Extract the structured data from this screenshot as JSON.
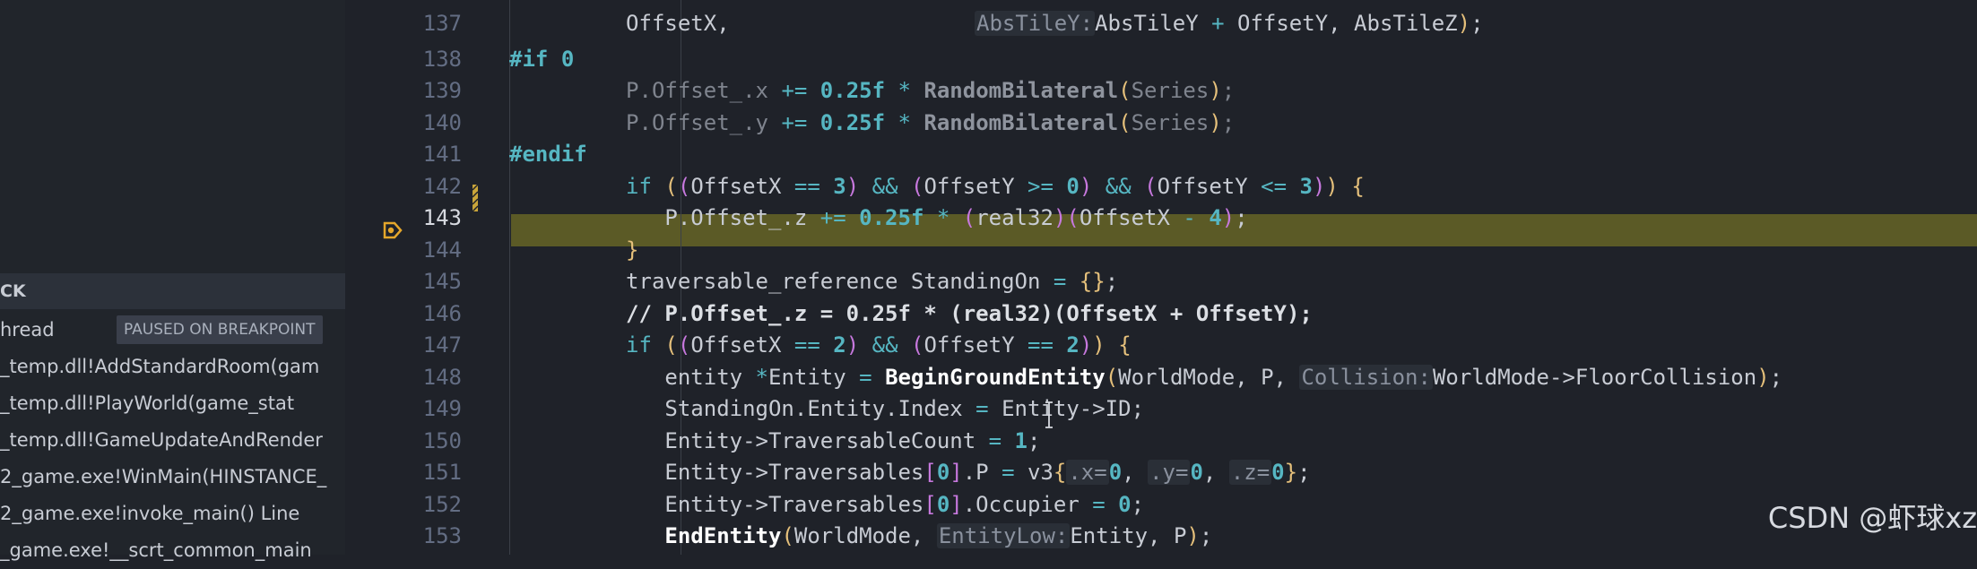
{
  "left_panel": {
    "section_title": "CK",
    "thread_label": "hread",
    "paused_badge": "PAUSED ON BREAKPOINT",
    "frames": [
      "_temp.dll!AddStandardRoom(gam",
      "_temp.dll!PlayWorld(game_stat",
      "_temp.dll!GameUpdateAndRender",
      "2_game.exe!WinMain(HINSTANCE_",
      "2_game.exe!invoke_main() Line",
      "_game.exe!__scrt_common_main"
    ]
  },
  "editor": {
    "current_line": 143,
    "lines": [
      {
        "n": "137",
        "t": [
          [
            "",
            "OffsetX,"
          ]
        ],
        "partial_top": true,
        "prev_tail": "",
        "extra": [
          [
            "hint",
            "AbsTileY:"
          ],
          [
            "",
            "AbsTileY "
          ],
          [
            "op",
            "+"
          ],
          [
            "",
            " OffsetY, AbsTileZ"
          ],
          [
            "br",
            ")"
          ],
          [
            "",
            ";"
          ]
        ]
      },
      {
        "n": "138",
        "t": [
          [
            "kwb",
            "#if"
          ],
          [
            "",
            " "
          ],
          [
            "num",
            "0"
          ]
        ]
      },
      {
        "n": "139",
        "t": [
          [
            "dim",
            "P.Offset_.x "
          ],
          [
            "op",
            "+="
          ],
          [
            "",
            " "
          ],
          [
            "num",
            "0.25f"
          ],
          [
            "",
            " "
          ],
          [
            "op",
            "*"
          ],
          [
            "",
            " "
          ],
          [
            "fnd",
            "RandomBilateral"
          ],
          [
            "br",
            "("
          ],
          [
            "dim",
            "Series"
          ],
          [
            "br",
            ")"
          ],
          [
            "dim",
            ";"
          ]
        ]
      },
      {
        "n": "140",
        "t": [
          [
            "dim",
            "P.Offset_.y "
          ],
          [
            "op",
            "+="
          ],
          [
            "",
            " "
          ],
          [
            "num",
            "0.25f"
          ],
          [
            "",
            " "
          ],
          [
            "op",
            "*"
          ],
          [
            "",
            " "
          ],
          [
            "fnd",
            "RandomBilateral"
          ],
          [
            "br",
            "("
          ],
          [
            "dim",
            "Series"
          ],
          [
            "br",
            ")"
          ],
          [
            "dim",
            ";"
          ]
        ]
      },
      {
        "n": "141",
        "t": [
          [
            "kwb",
            "#endif"
          ]
        ]
      },
      {
        "n": "142",
        "t": [
          [
            "kw",
            "if"
          ],
          [
            "",
            " "
          ],
          [
            "br",
            "("
          ],
          [
            "pr",
            "("
          ],
          [
            "",
            "OffsetX "
          ],
          [
            "op",
            "=="
          ],
          [
            "",
            " "
          ],
          [
            "num",
            "3"
          ],
          [
            "pr",
            ")"
          ],
          [
            "",
            " "
          ],
          [
            "op",
            "&&"
          ],
          [
            "",
            " "
          ],
          [
            "pr",
            "("
          ],
          [
            "",
            "OffsetY "
          ],
          [
            "op",
            ">="
          ],
          [
            "",
            " "
          ],
          [
            "num",
            "0"
          ],
          [
            "pr",
            ")"
          ],
          [
            "",
            " "
          ],
          [
            "op",
            "&&"
          ],
          [
            "",
            " "
          ],
          [
            "pr",
            "("
          ],
          [
            "",
            "OffsetY "
          ],
          [
            "op",
            "<="
          ],
          [
            "",
            " "
          ],
          [
            "num",
            "3"
          ],
          [
            "pr",
            ")"
          ],
          [
            "br",
            ")"
          ],
          [
            "",
            " "
          ],
          [
            "br",
            "{"
          ]
        ]
      },
      {
        "n": "143",
        "t": [
          [
            "",
            "P.Offset_.z "
          ],
          [
            "op",
            "+="
          ],
          [
            "",
            " "
          ],
          [
            "num",
            "0.25f"
          ],
          [
            "",
            " "
          ],
          [
            "op",
            "*"
          ],
          [
            "",
            " "
          ],
          [
            "pr",
            "("
          ],
          [
            "",
            "real32"
          ],
          [
            "pr",
            ")"
          ],
          [
            "pr",
            "("
          ],
          [
            "",
            "OffsetX "
          ],
          [
            "op",
            "-"
          ],
          [
            "",
            " "
          ],
          [
            "num",
            "4"
          ],
          [
            "pr",
            ")"
          ],
          [
            "",
            ";"
          ]
        ]
      },
      {
        "n": "144",
        "t": [
          [
            "br",
            "}"
          ]
        ]
      },
      {
        "n": "145",
        "t": [
          [
            "",
            "traversable_reference StandingOn "
          ],
          [
            "op",
            "="
          ],
          [
            "",
            " "
          ],
          [
            "br",
            "{}"
          ],
          [
            "",
            ";"
          ]
        ]
      },
      {
        "n": "146",
        "t": [
          [
            "cm",
            "// P.Offset_.z = 0.25f * (real32)(OffsetX + OffsetY);"
          ]
        ]
      },
      {
        "n": "147",
        "t": [
          [
            "kw",
            "if"
          ],
          [
            "",
            " "
          ],
          [
            "br",
            "("
          ],
          [
            "pr",
            "("
          ],
          [
            "",
            "OffsetX "
          ],
          [
            "op",
            "=="
          ],
          [
            "",
            " "
          ],
          [
            "num",
            "2"
          ],
          [
            "pr",
            ")"
          ],
          [
            "",
            " "
          ],
          [
            "op",
            "&&"
          ],
          [
            "",
            " "
          ],
          [
            "pr",
            "("
          ],
          [
            "",
            "OffsetY "
          ],
          [
            "op",
            "=="
          ],
          [
            "",
            " "
          ],
          [
            "num",
            "2"
          ],
          [
            "pr",
            ")"
          ],
          [
            "br",
            ")"
          ],
          [
            "",
            " "
          ],
          [
            "br",
            "{"
          ]
        ]
      },
      {
        "n": "148",
        "t": [
          [
            "",
            "entity "
          ],
          [
            "op",
            "*"
          ],
          [
            "",
            "Entity "
          ],
          [
            "op",
            "="
          ],
          [
            "",
            " "
          ],
          [
            "fn",
            "BeginGroundEntity"
          ],
          [
            "br",
            "("
          ],
          [
            "",
            "WorldMode, P, "
          ],
          [
            "hint",
            "Collision:"
          ],
          [
            "",
            "WorldMode->FloorCollision"
          ],
          [
            "br",
            ")"
          ],
          [
            "",
            ";"
          ]
        ]
      },
      {
        "n": "149",
        "t": [
          [
            "",
            "StandingOn.Entity.Index "
          ],
          [
            "op",
            "="
          ],
          [
            "",
            " Entity->ID;"
          ]
        ]
      },
      {
        "n": "150",
        "t": [
          [
            "",
            "Entity->TraversableCount "
          ],
          [
            "op",
            "="
          ],
          [
            "",
            " "
          ],
          [
            "num",
            "1"
          ],
          [
            "",
            ";"
          ]
        ]
      },
      {
        "n": "151",
        "t": [
          [
            "",
            "Entity->Traversables"
          ],
          [
            "pr",
            "["
          ],
          [
            "num",
            "0"
          ],
          [
            "pr",
            "]"
          ],
          [
            ".P "
          ],
          [
            "op",
            "="
          ],
          [
            "",
            " v3"
          ],
          [
            "br",
            "{"
          ],
          [
            "hint",
            ".x="
          ],
          [
            "num",
            "0"
          ],
          [
            ", "
          ],
          [
            "hint",
            ".y="
          ],
          [
            "num",
            "0"
          ],
          [
            ", "
          ],
          [
            "hint",
            ".z="
          ],
          [
            "num",
            "0"
          ],
          [
            "br",
            "}"
          ],
          [
            "",
            ";"
          ]
        ]
      },
      {
        "n": "152",
        "t": [
          [
            "",
            "Entity->Traversables"
          ],
          [
            "pr",
            "["
          ],
          [
            "num",
            "0"
          ],
          [
            "pr",
            "]"
          ],
          [
            "",
            ".Occupier "
          ],
          [
            "op",
            "="
          ],
          [
            "",
            " "
          ],
          [
            "num",
            "0"
          ],
          [
            "",
            ";"
          ]
        ]
      },
      {
        "n": "153",
        "t": [
          [
            "fn",
            "EndEntity"
          ],
          [
            "br",
            "("
          ],
          [
            "",
            "WorldMode, "
          ],
          [
            "hint",
            "EntityLow:"
          ],
          [
            "",
            "Entity, P"
          ],
          [
            "br",
            ")"
          ],
          [
            "",
            ";"
          ]
        ]
      }
    ]
  },
  "watermark": "CSDN @虾球xz",
  "colors": {
    "editor_bg": "#1f2229",
    "current_line_bg": "#5b5a26",
    "breakpoint_arrow": "#e5a72b",
    "keyword": "#56b6c2",
    "bracket": "#e5c07b",
    "paren": "#c678dd"
  }
}
